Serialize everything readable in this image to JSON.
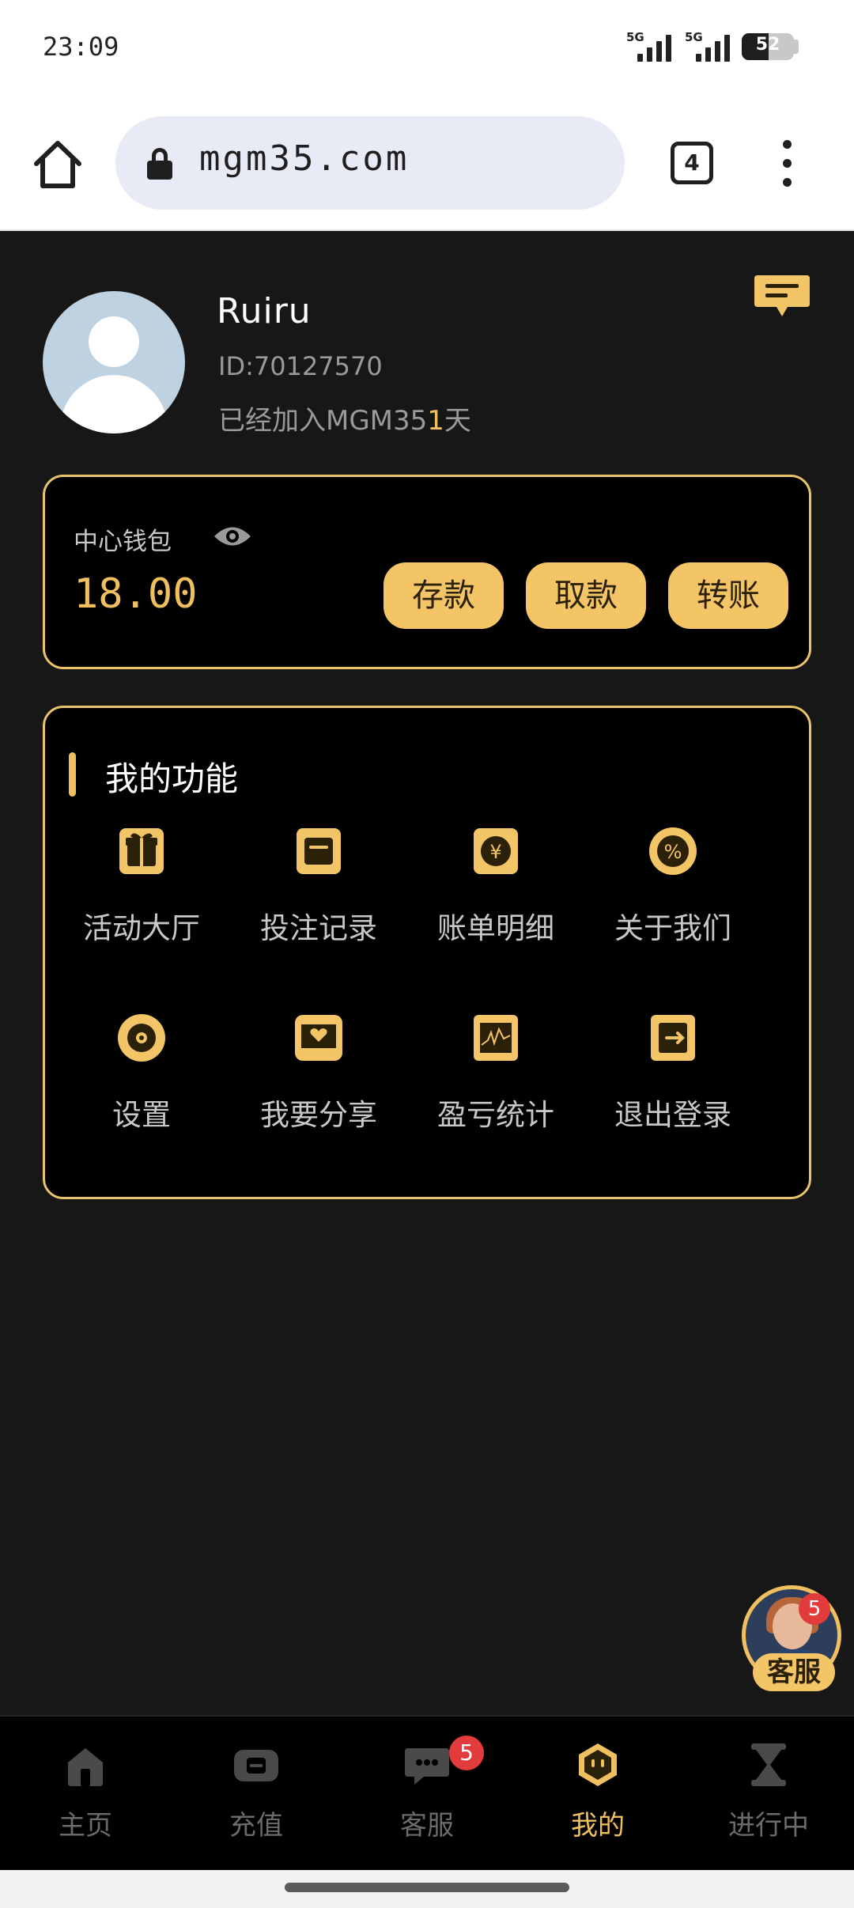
{
  "status_bar": {
    "time": "23:09",
    "signal_1": "5G",
    "signal_2": "5G",
    "battery": "52"
  },
  "browser": {
    "url": "mgm35.com",
    "tab_count": "4"
  },
  "profile": {
    "username": "Ruiru",
    "id_text": "ID:70127570",
    "joined_prefix": "已经加入MGM35",
    "joined_days": "1",
    "joined_suffix": "天"
  },
  "wallet": {
    "label": "中心钱包",
    "balance": "18.00",
    "deposit": "存款",
    "withdraw": "取款",
    "transfer": "转账"
  },
  "functions": {
    "title": "我的功能",
    "items": [
      {
        "label": "活动大厅",
        "icon": "gift-icon"
      },
      {
        "label": "投注记录",
        "icon": "bet-record-icon"
      },
      {
        "label": "账单明细",
        "icon": "yen-coin-icon"
      },
      {
        "label": "关于我们",
        "icon": "percent-icon"
      },
      {
        "label": "设置",
        "icon": "settings-gear-icon"
      },
      {
        "label": "我要分享",
        "icon": "share-heart-icon"
      },
      {
        "label": "盈亏统计",
        "icon": "profit-chart-icon"
      },
      {
        "label": "退出登录",
        "icon": "logout-icon"
      }
    ]
  },
  "float_service": {
    "label": "客服",
    "badge": "5"
  },
  "bottom_nav": {
    "items": [
      {
        "label": "主页",
        "icon": "home-icon"
      },
      {
        "label": "充值",
        "icon": "recharge-icon"
      },
      {
        "label": "客服",
        "icon": "chat-icon"
      },
      {
        "label": "我的",
        "icon": "profile-icon"
      },
      {
        "label": "进行中",
        "icon": "hourglass-icon"
      }
    ],
    "service_badge": "5",
    "active_index": 3
  },
  "colors": {
    "accent_gold": "#f0c060",
    "button_gold": "#f3c566",
    "background": "#171717",
    "card": "#000000",
    "badge_red": "#e23b3b"
  }
}
